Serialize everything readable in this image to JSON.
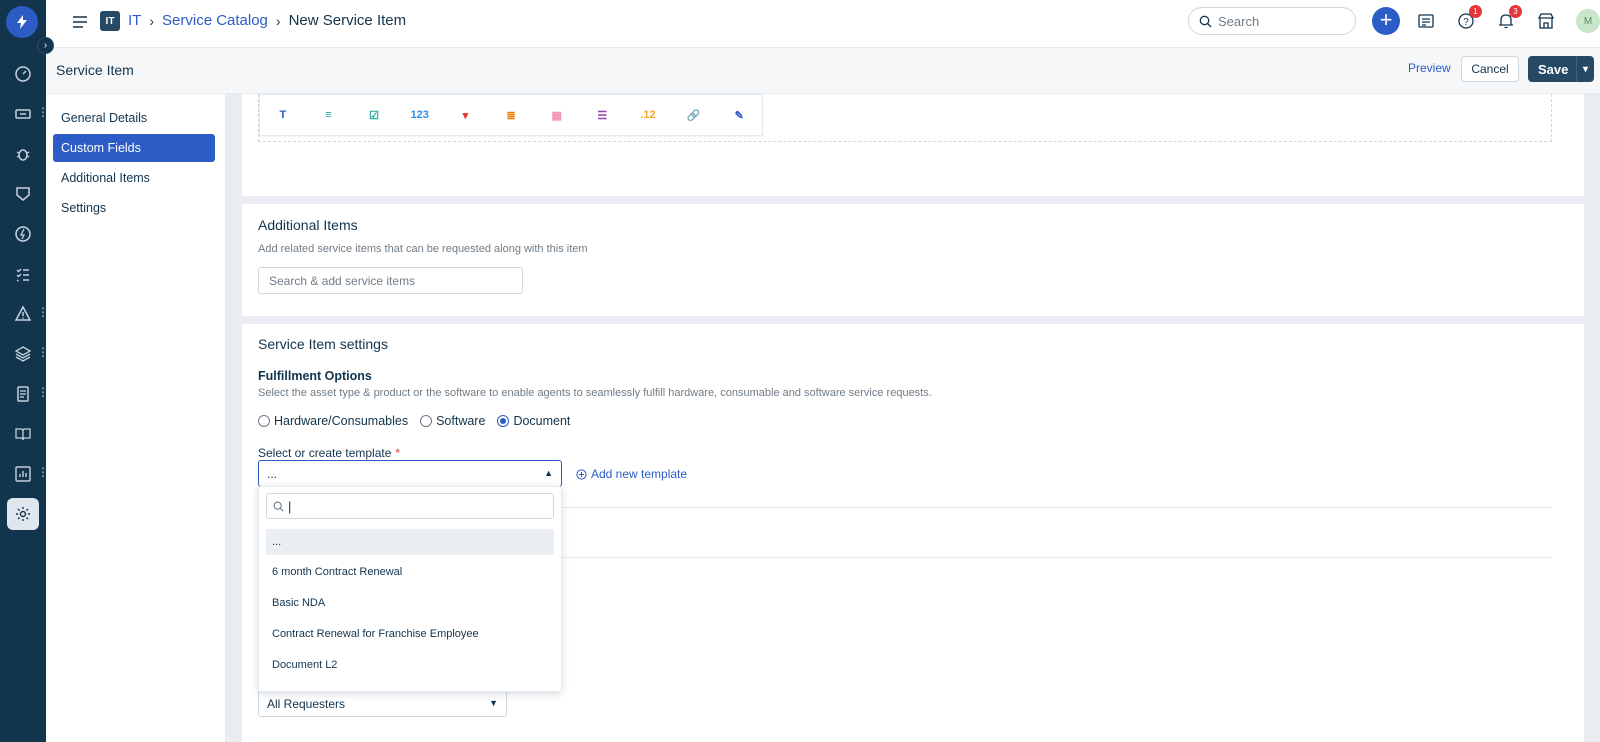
{
  "topbar": {
    "workspace_badge": "IT",
    "breadcrumb": [
      "IT",
      "Service Catalog",
      "New Service Item"
    ],
    "search_placeholder": "Search",
    "help_count": "1",
    "notification_count": "3",
    "avatar_initial": "M"
  },
  "page": {
    "title": "Service Item",
    "preview_label": "Preview",
    "cancel_label": "Cancel",
    "save_label": "Save"
  },
  "subnav": {
    "items": [
      {
        "label": "General Details",
        "active": false
      },
      {
        "label": "Custom Fields",
        "active": true
      },
      {
        "label": "Additional Items",
        "active": false
      },
      {
        "label": "Settings",
        "active": false
      }
    ]
  },
  "toolbar": {
    "items": [
      {
        "icon": "text-icon",
        "glyph": "T",
        "color": "#2c5cc5"
      },
      {
        "icon": "paragraph-icon",
        "glyph": "≡",
        "color": "#26a69a"
      },
      {
        "icon": "checkbox-icon",
        "glyph": "☑",
        "color": "#26a69a"
      },
      {
        "icon": "number-icon",
        "glyph": "123",
        "color": "#2c91e6"
      },
      {
        "icon": "dropdown-icon",
        "glyph": "▾",
        "color": "#e43538"
      },
      {
        "icon": "multi-select-icon",
        "glyph": "≣",
        "color": "#f57c00"
      },
      {
        "icon": "date-icon",
        "glyph": "▦",
        "color": "#f48fb1"
      },
      {
        "icon": "nested-field-icon",
        "glyph": "☰",
        "color": "#8e44ad"
      },
      {
        "icon": "decimal-icon",
        "glyph": ".12",
        "color": "#f5a623"
      },
      {
        "icon": "link-icon",
        "glyph": "🔗",
        "color": "#2c5cc5"
      },
      {
        "icon": "edit-icon",
        "glyph": "✎",
        "color": "#2c5cc5"
      }
    ]
  },
  "additional_items": {
    "title": "Additional Items",
    "hint": "Add related service items that can be requested along with this item",
    "search_placeholder": "Search & add service items"
  },
  "settings": {
    "title": "Service Item settings",
    "fulfillment_label": "Fulfillment Options",
    "fulfillment_hint": "Select the asset type & product or the software to enable agents to seamlessly fulfill hardware, consumable and software service requests.",
    "options": [
      {
        "label": "Hardware/Consumables",
        "selected": false
      },
      {
        "label": "Software",
        "selected": false
      },
      {
        "label": "Document",
        "selected": true
      }
    ],
    "template_label": "Select or create template",
    "template_value": "...",
    "add_template_label": "Add new template",
    "dropdown_options": [
      "...",
      "6 month Contract Renewal",
      "Basic NDA",
      "Contract Renewal for Franchise Employee",
      "Document L2"
    ],
    "requesters_value": "All Requesters"
  }
}
